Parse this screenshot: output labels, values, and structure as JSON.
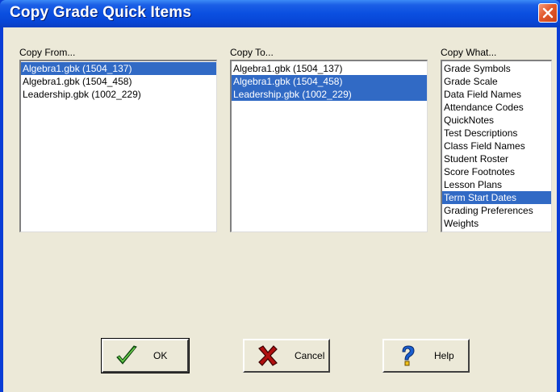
{
  "window": {
    "title": "Copy Grade Quick Items"
  },
  "copy_from": {
    "label": "Copy From...",
    "items": [
      {
        "text": "Algebra1.gbk (1504_137)",
        "selected": true
      },
      {
        "text": "Algebra1.gbk (1504_458)",
        "selected": false
      },
      {
        "text": "Leadership.gbk (1002_229)",
        "selected": false
      }
    ]
  },
  "copy_to": {
    "label": "Copy To...",
    "items": [
      {
        "text": "Algebra1.gbk (1504_137)",
        "selected": false
      },
      {
        "text": "Algebra1.gbk (1504_458)",
        "selected": true
      },
      {
        "text": "Leadership.gbk (1002_229)",
        "selected": true
      }
    ]
  },
  "copy_what": {
    "label": "Copy What...",
    "items": [
      {
        "text": "Grade Symbols",
        "selected": false
      },
      {
        "text": "Grade Scale",
        "selected": false
      },
      {
        "text": "Data Field Names",
        "selected": false
      },
      {
        "text": "Attendance Codes",
        "selected": false
      },
      {
        "text": "QuickNotes",
        "selected": false
      },
      {
        "text": "Test Descriptions",
        "selected": false
      },
      {
        "text": "Class Field Names",
        "selected": false
      },
      {
        "text": "Student Roster",
        "selected": false
      },
      {
        "text": "Score Footnotes",
        "selected": false
      },
      {
        "text": "Lesson Plans",
        "selected": false
      },
      {
        "text": "Term Start Dates",
        "selected": true
      },
      {
        "text": "Grading Preferences",
        "selected": false
      },
      {
        "text": "Weights",
        "selected": false
      }
    ]
  },
  "buttons": {
    "ok": {
      "label": "OK",
      "icon": "checkmark-icon"
    },
    "cancel": {
      "label": "Cancel",
      "icon": "x-icon"
    },
    "help": {
      "label": "Help",
      "icon": "question-mark-icon"
    }
  },
  "colors": {
    "selection": "#316ac5",
    "titlebar": "#0a4fe0",
    "dialog_bg": "#ece9d8"
  }
}
